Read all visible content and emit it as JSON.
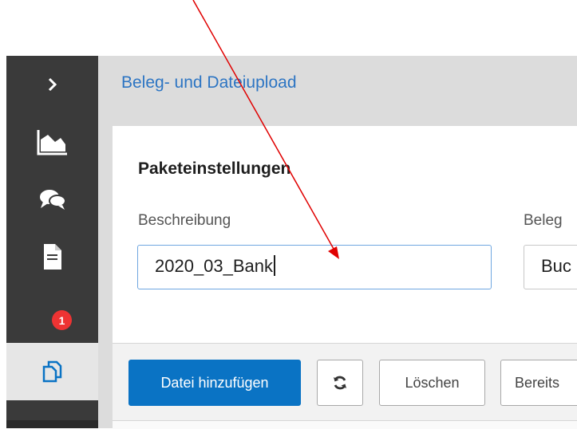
{
  "sidebar": {
    "expand_icon": "chevron-right-icon",
    "items": [
      {
        "icon": "area-chart-icon"
      },
      {
        "icon": "chat-bubbles-icon"
      },
      {
        "icon": "document-icon",
        "badge": "1"
      },
      {
        "icon": "copy-documents-icon"
      }
    ]
  },
  "header": {
    "title": "Beleg- und Dateiupload"
  },
  "section": {
    "title": "Paketeinstellungen"
  },
  "fields": {
    "description_label": "Beschreibung",
    "description_value": "2020_03_Bank",
    "type_label": "Beleg",
    "type_value": "Buc"
  },
  "toolbar": {
    "add_file_label": "Datei hinzufügen",
    "refresh_icon": "refresh-icon",
    "delete_label": "Löschen",
    "ready_label": "Bereits"
  },
  "colors": {
    "accent": "#0a73c4",
    "header_link": "#2d75c3",
    "sidebar": "#3a3a3a",
    "annotation_arrow": "#e00000"
  }
}
